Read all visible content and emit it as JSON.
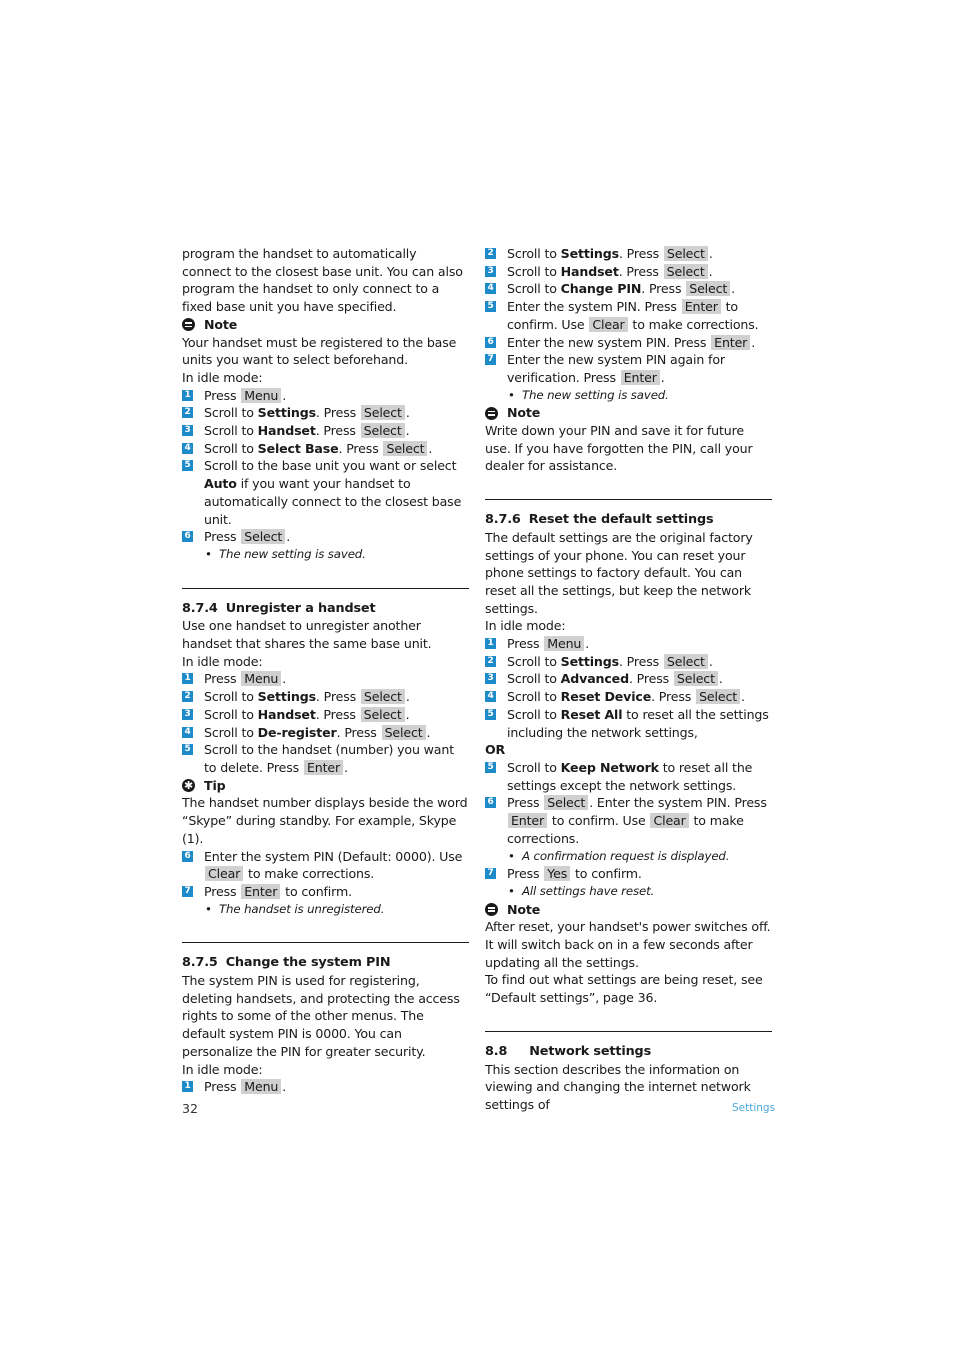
{
  "left": {
    "intro": "program the handset to automatically connect to the closest base unit. You can also program the handset to only connect to a fixed base unit you have specified.",
    "note1": {
      "title": "Note",
      "text": "Your handset must be registered to the base units you want to select beforehand."
    },
    "idle_label": "In idle mode:",
    "steps_a": [
      {
        "num": "1",
        "pre": "Press ",
        "bold": "",
        "mid": "",
        "key": "Menu",
        "post": "."
      },
      {
        "num": "2",
        "pre": "Scroll to ",
        "bold": "Settings",
        "mid": ". Press ",
        "key": "Select",
        "post": "."
      },
      {
        "num": "3",
        "pre": "Scroll to ",
        "bold": "Handset",
        "mid": ". Press ",
        "key": "Select",
        "post": "."
      },
      {
        "num": "4",
        "pre": "Scroll to ",
        "bold": "Select Base",
        "mid": ". Press ",
        "key": "Select",
        "post": "."
      }
    ],
    "step_a5": {
      "num": "5",
      "pre": "Scroll to the base unit you want or select ",
      "bold": "Auto",
      "post": " if you want your handset to automatically connect to the closest base unit."
    },
    "step_a6": {
      "num": "6",
      "pre": "Press ",
      "key": "Select",
      "post": "."
    },
    "bullet_a": "The new setting is saved.",
    "section_874": {
      "number": "8.7.4",
      "title": "Unregister a handset",
      "intro": "Use one handset to unregister another handset that shares the same base unit.",
      "idle_label": "In idle mode:",
      "steps": [
        {
          "num": "1",
          "pre": "Press ",
          "bold": "",
          "mid": "",
          "key": "Menu",
          "post": "."
        },
        {
          "num": "2",
          "pre": "Scroll to ",
          "bold": "Settings",
          "mid": ". Press ",
          "key": "Select",
          "post": "."
        },
        {
          "num": "3",
          "pre": "Scroll to ",
          "bold": "Handset",
          "mid": ". Press ",
          "key": "Select",
          "post": "."
        },
        {
          "num": "4",
          "pre": "Scroll to ",
          "bold": "De-register",
          "mid": ". Press ",
          "key": "Select",
          "post": "."
        }
      ],
      "step5": {
        "num": "5",
        "pre": "Scroll to the handset (number) you want to delete. Press ",
        "key": "Enter",
        "post": "."
      },
      "tip": {
        "title": "Tip",
        "text": "The handset number displays beside the word “Skype” during standby. For example, Skype (1)."
      },
      "step6": {
        "num": "6",
        "pre": "Enter the system PIN (Default: 0000). Use ",
        "key": "Clear",
        "post": " to make corrections."
      },
      "step7": {
        "num": "7",
        "pre": "Press ",
        "key": "Enter",
        "post": " to confirm."
      },
      "bullet": "The handset is unregistered."
    },
    "section_875": {
      "number": "8.7.5",
      "title": "Change the system PIN",
      "intro": "The system PIN is used for registering, deleting handsets, and protecting the access rights to some of the other menus. The default system PIN is 0000. You can personalize the PIN for greater security.",
      "idle_label": "In idle mode:",
      "step1": {
        "num": "1",
        "pre": "Press ",
        "key": "Menu",
        "post": "."
      }
    }
  },
  "right": {
    "steps_875": [
      {
        "num": "2",
        "pre": "Scroll to ",
        "bold": "Settings",
        "mid": ". Press ",
        "key": "Select",
        "post": "."
      },
      {
        "num": "3",
        "pre": "Scroll to ",
        "bold": "Handset",
        "mid": ". Press ",
        "key": "Select",
        "post": "."
      },
      {
        "num": "4",
        "pre": "Scroll to ",
        "bold": "Change PIN",
        "mid": ". Press ",
        "key": "Select",
        "post": "."
      }
    ],
    "step5": {
      "num": "5",
      "pre": "Enter the system PIN. Press ",
      "key1": "Enter",
      "mid": " to confirm. Use ",
      "key2": "Clear",
      "post": " to make corrections."
    },
    "step6": {
      "num": "6",
      "pre": "Enter the new system PIN. Press ",
      "key": "Enter",
      "post": "."
    },
    "step7": {
      "num": "7",
      "pre": "Enter the new system PIN again for verification. Press ",
      "key": "Enter",
      "post": "."
    },
    "bullet_875": "The new setting is saved.",
    "note2": {
      "title": "Note",
      "text": "Write down your PIN and save it for future use. If you have forgotten the PIN, call your dealer for assistance."
    },
    "section_876": {
      "number": "8.7.6",
      "title": "Reset the default settings",
      "intro": "The default settings are the original factory settings of your phone. You can reset your phone settings to factory default. You can reset all the settings, but keep the network settings.",
      "idle_label": "In idle mode:",
      "steps": [
        {
          "num": "1",
          "pre": "Press ",
          "bold": "",
          "mid": "",
          "key": "Menu",
          "post": "."
        },
        {
          "num": "2",
          "pre": "Scroll to ",
          "bold": "Settings",
          "mid": ". Press ",
          "key": "Select",
          "post": "."
        },
        {
          "num": "3",
          "pre": "Scroll to ",
          "bold": "Advanced",
          "mid": ". Press ",
          "key": "Select",
          "post": "."
        },
        {
          "num": "4",
          "pre": "Scroll to ",
          "bold": "Reset Device",
          "mid": ". Press ",
          "key": "Select",
          "post": "."
        }
      ],
      "step5a": {
        "num": "5",
        "pre": "Scroll to ",
        "bold": "Reset All",
        "post": " to reset all the settings including the network settings,"
      },
      "or_label": "OR",
      "step5b": {
        "num": "5",
        "pre": "Scroll to ",
        "bold": "Keep Network",
        "post": " to reset all the settings except the network settings."
      },
      "step6": {
        "num": "6",
        "pre": "Press ",
        "key1": "Select",
        "mid1": ". Enter the system PIN. Press ",
        "key2": "Enter",
        "mid2": " to confirm. Use ",
        "key3": "Clear",
        "post": " to make corrections."
      },
      "bullet6": "A confirmation request is displayed.",
      "step7": {
        "num": "7",
        "pre": "Press ",
        "key": "Yes",
        "post": " to confirm."
      },
      "bullet7": "All settings have reset.",
      "note": {
        "title": "Note",
        "text1": "After reset, your handset's power switches off. It will switch back on in a few seconds after updating all the settings.",
        "text2": "To find out what settings are being reset, see “Default settings”, page 36."
      }
    },
    "section_88": {
      "number": "8.8",
      "title": "Network settings",
      "intro": "This section describes the information on viewing and changing the internet network settings of"
    }
  },
  "footer": {
    "page_number": "32",
    "section_name": "Settings"
  },
  "colors": {
    "badge": "#1d8ac9",
    "key_bg": "#d0d0d0",
    "footer_accent": "#4aa8de"
  }
}
